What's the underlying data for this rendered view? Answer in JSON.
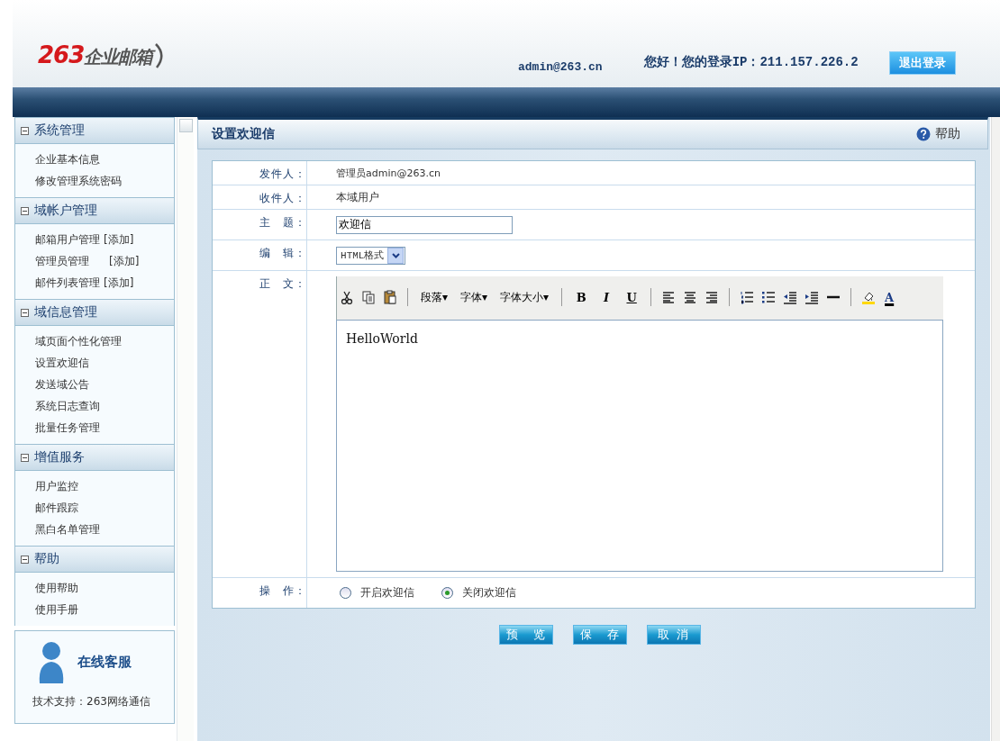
{
  "header": {
    "logo_number": "263",
    "logo_text": "企业邮箱",
    "account": "admin@263.cn",
    "greeting": "您好！您的登录IP：211.157.226.2",
    "logout": "退出登录"
  },
  "sidebar": {
    "sections": [
      {
        "title": "系统管理",
        "expanded": true,
        "items": [
          {
            "label": "企业基本信息"
          },
          {
            "label": "修改管理系统密码"
          }
        ]
      },
      {
        "title": "域帐户管理",
        "expanded": true,
        "items": [
          {
            "label": "邮箱用户管理",
            "extra": "[添加]"
          },
          {
            "label": "管理员管理",
            "extra": "[添加]"
          },
          {
            "label": "邮件列表管理",
            "extra": "[添加]"
          }
        ]
      },
      {
        "title": "域信息管理",
        "expanded": true,
        "items": [
          {
            "label": "域页面个性化管理"
          },
          {
            "label": "设置欢迎信"
          },
          {
            "label": "发送域公告"
          },
          {
            "label": "系统日志查询"
          },
          {
            "label": "批量任务管理"
          }
        ]
      },
      {
        "title": "增值服务",
        "expanded": true,
        "items": [
          {
            "label": "用户监控"
          },
          {
            "label": "邮件跟踪"
          },
          {
            "label": "黑白名单管理"
          }
        ]
      },
      {
        "title": "帮助",
        "expanded": true,
        "items": [
          {
            "label": "使用帮助"
          },
          {
            "label": "使用手册"
          }
        ]
      }
    ],
    "support": {
      "title": "在线客服",
      "footer": "技术支持：263网络通信"
    }
  },
  "panel": {
    "title": "设置欢迎信",
    "help": "帮助",
    "form": {
      "sender_label": "发件人：",
      "sender": "管理员admin@263.cn",
      "recipient_label": "收件人：",
      "recipient": "本域用户",
      "subject_label": "主　题：",
      "subject": "欢迎信",
      "editor_label": "编　辑：",
      "editor_mode": "HTML格式",
      "body_label": "正　文：",
      "body": "HelloWorld",
      "action_label": "操　作：",
      "toolbar": [
        {
          "kind": "cut"
        },
        {
          "kind": "copy"
        },
        {
          "kind": "paste"
        },
        {
          "kind": "sep"
        },
        {
          "kind": "menu",
          "label": "段落▾"
        },
        {
          "kind": "menu",
          "label": "字体▾"
        },
        {
          "kind": "menu",
          "label": "字体大小▾"
        },
        {
          "kind": "sep"
        },
        {
          "kind": "bold",
          "label": "B"
        },
        {
          "kind": "italic",
          "label": "I"
        },
        {
          "kind": "underline",
          "label": "U"
        },
        {
          "kind": "sep"
        },
        {
          "kind": "alignleft"
        },
        {
          "kind": "aligncenter"
        },
        {
          "kind": "alignright"
        },
        {
          "kind": "sep"
        },
        {
          "kind": "ordered"
        },
        {
          "kind": "bullets"
        },
        {
          "kind": "outdent"
        },
        {
          "kind": "indent"
        },
        {
          "kind": "rule"
        },
        {
          "kind": "sep"
        },
        {
          "kind": "highlight"
        },
        {
          "kind": "textcolor",
          "label": "A"
        }
      ],
      "options": [
        {
          "label": "开启欢迎信",
          "selected": false
        },
        {
          "label": "关闭欢迎信",
          "selected": true
        }
      ]
    },
    "buttons": [
      "预　览",
      "保　存",
      "取 消"
    ]
  }
}
